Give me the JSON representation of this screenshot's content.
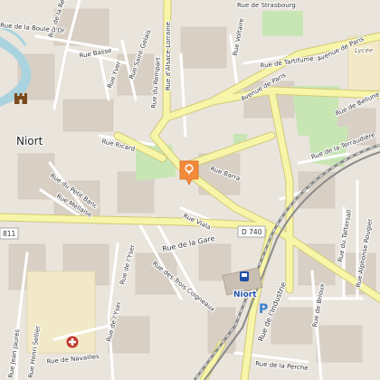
{
  "city_label": "Niort",
  "station_label": "Niort",
  "route_shields": [
    "D 740",
    "811"
  ],
  "streets": {
    "rue_de_la_regratterie": "Rue de la Regratterie",
    "rue_de_strasbourg": "Rue de Strasbourg",
    "rue_de_la_boule_dor": "Rue de la Boule d'Or",
    "rue_basse": "Rue Basse",
    "rue_saint_gelais": "Rue Saint-Gelais",
    "rue_yver": "Rue Yver",
    "rue_du_rempart": "Rue du Rempart",
    "rue_dalsace_lorraine": "Rue d'Alsace-Lorraine",
    "rue_voltaire": "Rue Voltaire",
    "rue_de_tartifume": "Rue de Tartifume",
    "avenue_de_paris": "Avenue de Paris",
    "avenue_de_paris_2": "Avenue de Paris",
    "rue_de_bellune": "Rue de Bellune",
    "rue_ricard": "Rue Ricard",
    "rue_barra": "Rue Barra",
    "rue_de_la_terraudiere": "Rue de la Terraudière",
    "rue_du_petit_banc": "Rue du Petit Banc",
    "rue_mellaise": "Rue Mellaise",
    "rue_viala": "Rue Viala",
    "rue_de_la_gare": "Rue de la Gare",
    "rue_des_trois_coigneaux": "Rue des Trois Coigneaux",
    "rue_de_lyser": "Rue de l'Yser",
    "rue_de_lyser_2": "Rue de l'Yser",
    "rue_du_tattersall": "Rue du Tattersall",
    "rue_alphonse_rougier": "Rue Alphonse Rougier",
    "rue_de_lindustrie": "Rue de l'Industrie",
    "rue_de_brioux": "Rue de Brioux",
    "rue_henri_sellier": "Rue Henri Sellier",
    "rue_jean_jaures": "Rue Jean Jaurès",
    "rue_de_navailles": "Rue de Navailles",
    "rue_de_la_perche": "Rue de la Perche",
    "lycee": "Lycée"
  },
  "colors": {
    "background": "#e9e4dc",
    "building": "#d9d0c5",
    "major_road": "#f7f5a8",
    "major_road_casing": "#d2c978",
    "minor_road": "#ffffff",
    "park": "#c8e6b4",
    "water": "#a9d3df",
    "railway": "#8a8a8a",
    "marker": "#f2893b",
    "hospital": "#c0392b",
    "parking": "#3b7fd4"
  }
}
